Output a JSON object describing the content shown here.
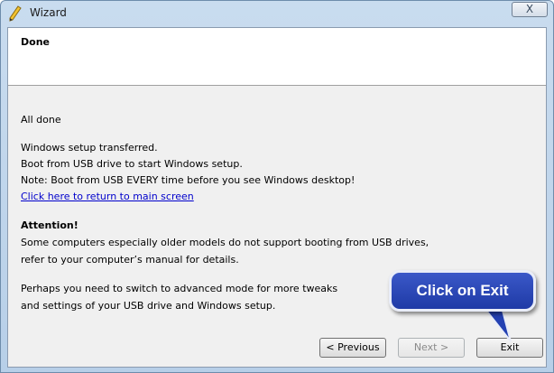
{
  "window": {
    "title": "Wizard",
    "close_glyph": "X",
    "icon": "pencil-icon"
  },
  "header": {
    "title": "Done"
  },
  "content": {
    "line1": "All done",
    "line2": "Windows setup transferred.",
    "line3": "Boot from USB drive to start Windows setup.",
    "line4": "Note: Boot from USB EVERY time before you see Windows desktop!",
    "link": "Click here to return to main screen",
    "attention": "Attention!",
    "line6": "Some computers especially older models do not support booting from USB drives,",
    "line7": "refer to your computer’s manual for details.",
    "line8": "Perhaps you need to switch to advanced mode for more tweaks",
    "line9": "and settings of your USB drive and Windows setup."
  },
  "buttons": {
    "previous": "< Previous",
    "next": "Next >",
    "exit": "Exit"
  },
  "callout": {
    "text": "Click on Exit",
    "color": "#2945b8"
  }
}
